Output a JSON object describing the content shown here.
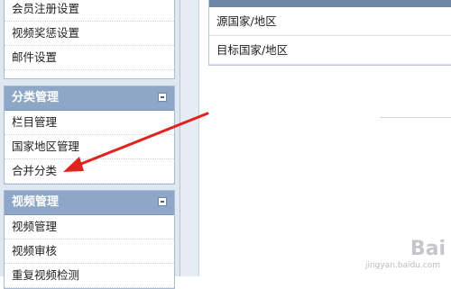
{
  "sidebar": {
    "panel1": {
      "items": [
        "会员注册设置",
        "视频奖惩设置",
        "邮件设置"
      ]
    },
    "panel2": {
      "title": "分类管理",
      "items": [
        "栏目管理",
        "国家地区管理",
        "合并分类"
      ]
    },
    "panel3": {
      "title": "视频管理",
      "items": [
        "视频管理",
        "视频审核",
        "重复视频检测"
      ]
    }
  },
  "main": {
    "form_rows": [
      "源国家/地区",
      "目标国家/地区"
    ]
  },
  "annotation": {
    "arrow_color": "#e0231c"
  },
  "watermark": {
    "text": "Bai",
    "sub": "jingyan.baidu.com"
  }
}
